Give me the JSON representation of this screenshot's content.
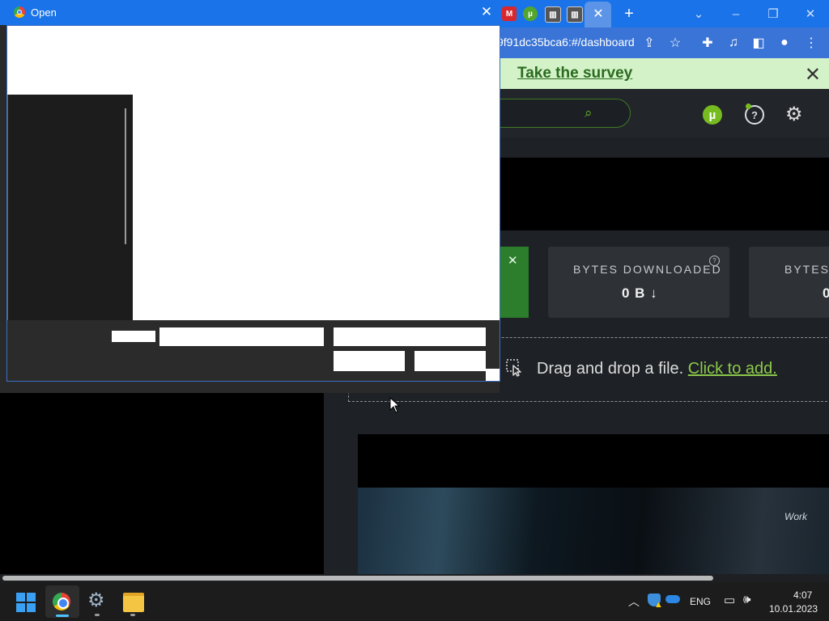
{
  "browser": {
    "tabs": [
      {
        "icon": "mega-icon",
        "glyph": "M",
        "color": "#d9272e"
      },
      {
        "icon": "utorrent-icon",
        "glyph": "µ",
        "color": "#52a52e"
      },
      {
        "icon": "library-icon",
        "glyph": "▥",
        "color": "#555555"
      },
      {
        "icon": "library-icon",
        "glyph": "▥",
        "color": "#555555"
      }
    ],
    "active_tab_close": "✕",
    "new_tab": "+",
    "url_fragment": "9f91dc35bca6:#/dashboard"
  },
  "survey": {
    "link": "Take the survey",
    "close": "✕"
  },
  "app": {
    "stats": [
      {
        "label": "BYTES DOWNLOADED",
        "value": "0 B ↓"
      },
      {
        "label": "BYTES U",
        "value": "0"
      }
    ],
    "dropzone": {
      "text": "Drag and drop a file.",
      "link": "Click to add."
    },
    "video_word": "Work"
  },
  "dialog": {
    "title": "Open",
    "close": "✕"
  },
  "taskbar": {
    "language": "ENG",
    "time": "4:07",
    "date": "10.01.2023"
  }
}
